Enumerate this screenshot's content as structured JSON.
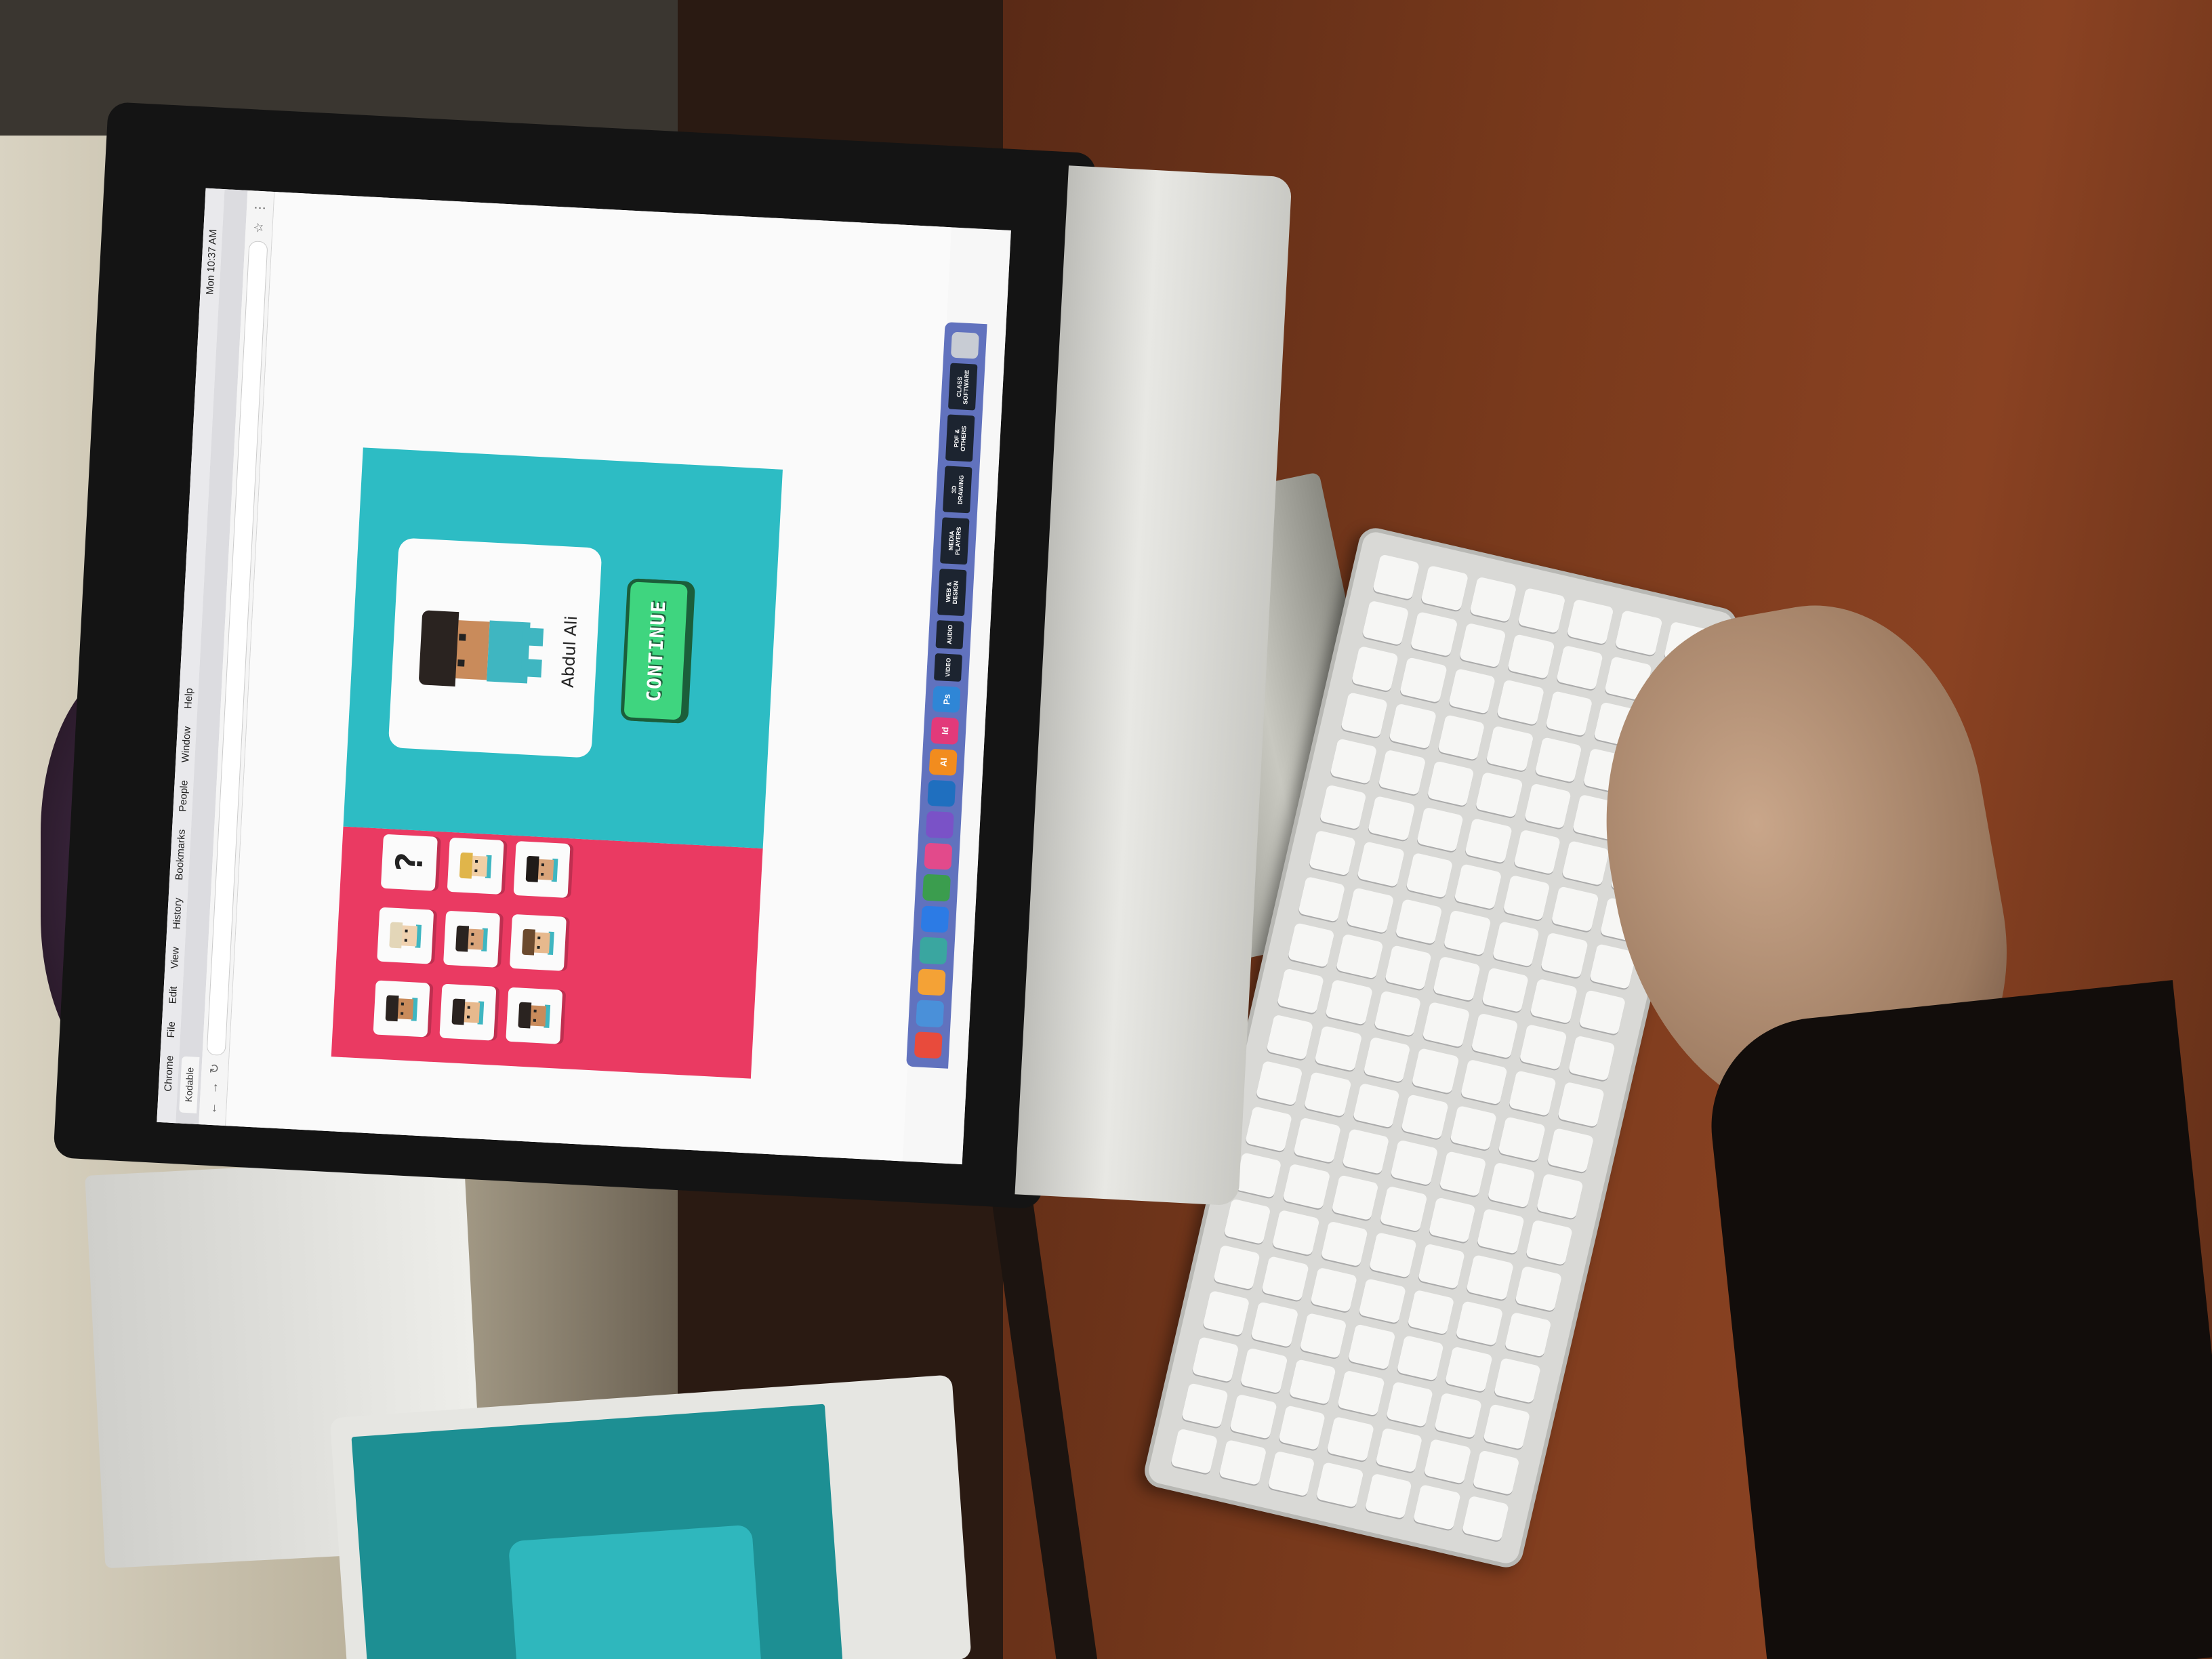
{
  "menubar": {
    "items": [
      "Chrome",
      "File",
      "Edit",
      "View",
      "History",
      "Bookmarks",
      "People",
      "Window",
      "Help"
    ],
    "clock": "Mon 10:37 AM"
  },
  "browser": {
    "tab_title": "Kodable",
    "url": ""
  },
  "game": {
    "selected_character_name": "Abdul Ali",
    "continue_label": "CONTINUE",
    "mystery_label": "?",
    "accent_colors": {
      "teal": "#2dbcc4",
      "pink": "#ea3a62",
      "green": "#3fd57f"
    }
  },
  "dock": {
    "app_labels": [
      "AI",
      "Id",
      "Ps"
    ],
    "folders": [
      "VIDEO",
      "AUDIO",
      "WEB & DESIGN",
      "MEDIA PLAYERS",
      "3D DRAWING",
      "PDF & OTHERS",
      "CLASS SOFTWARE"
    ]
  }
}
